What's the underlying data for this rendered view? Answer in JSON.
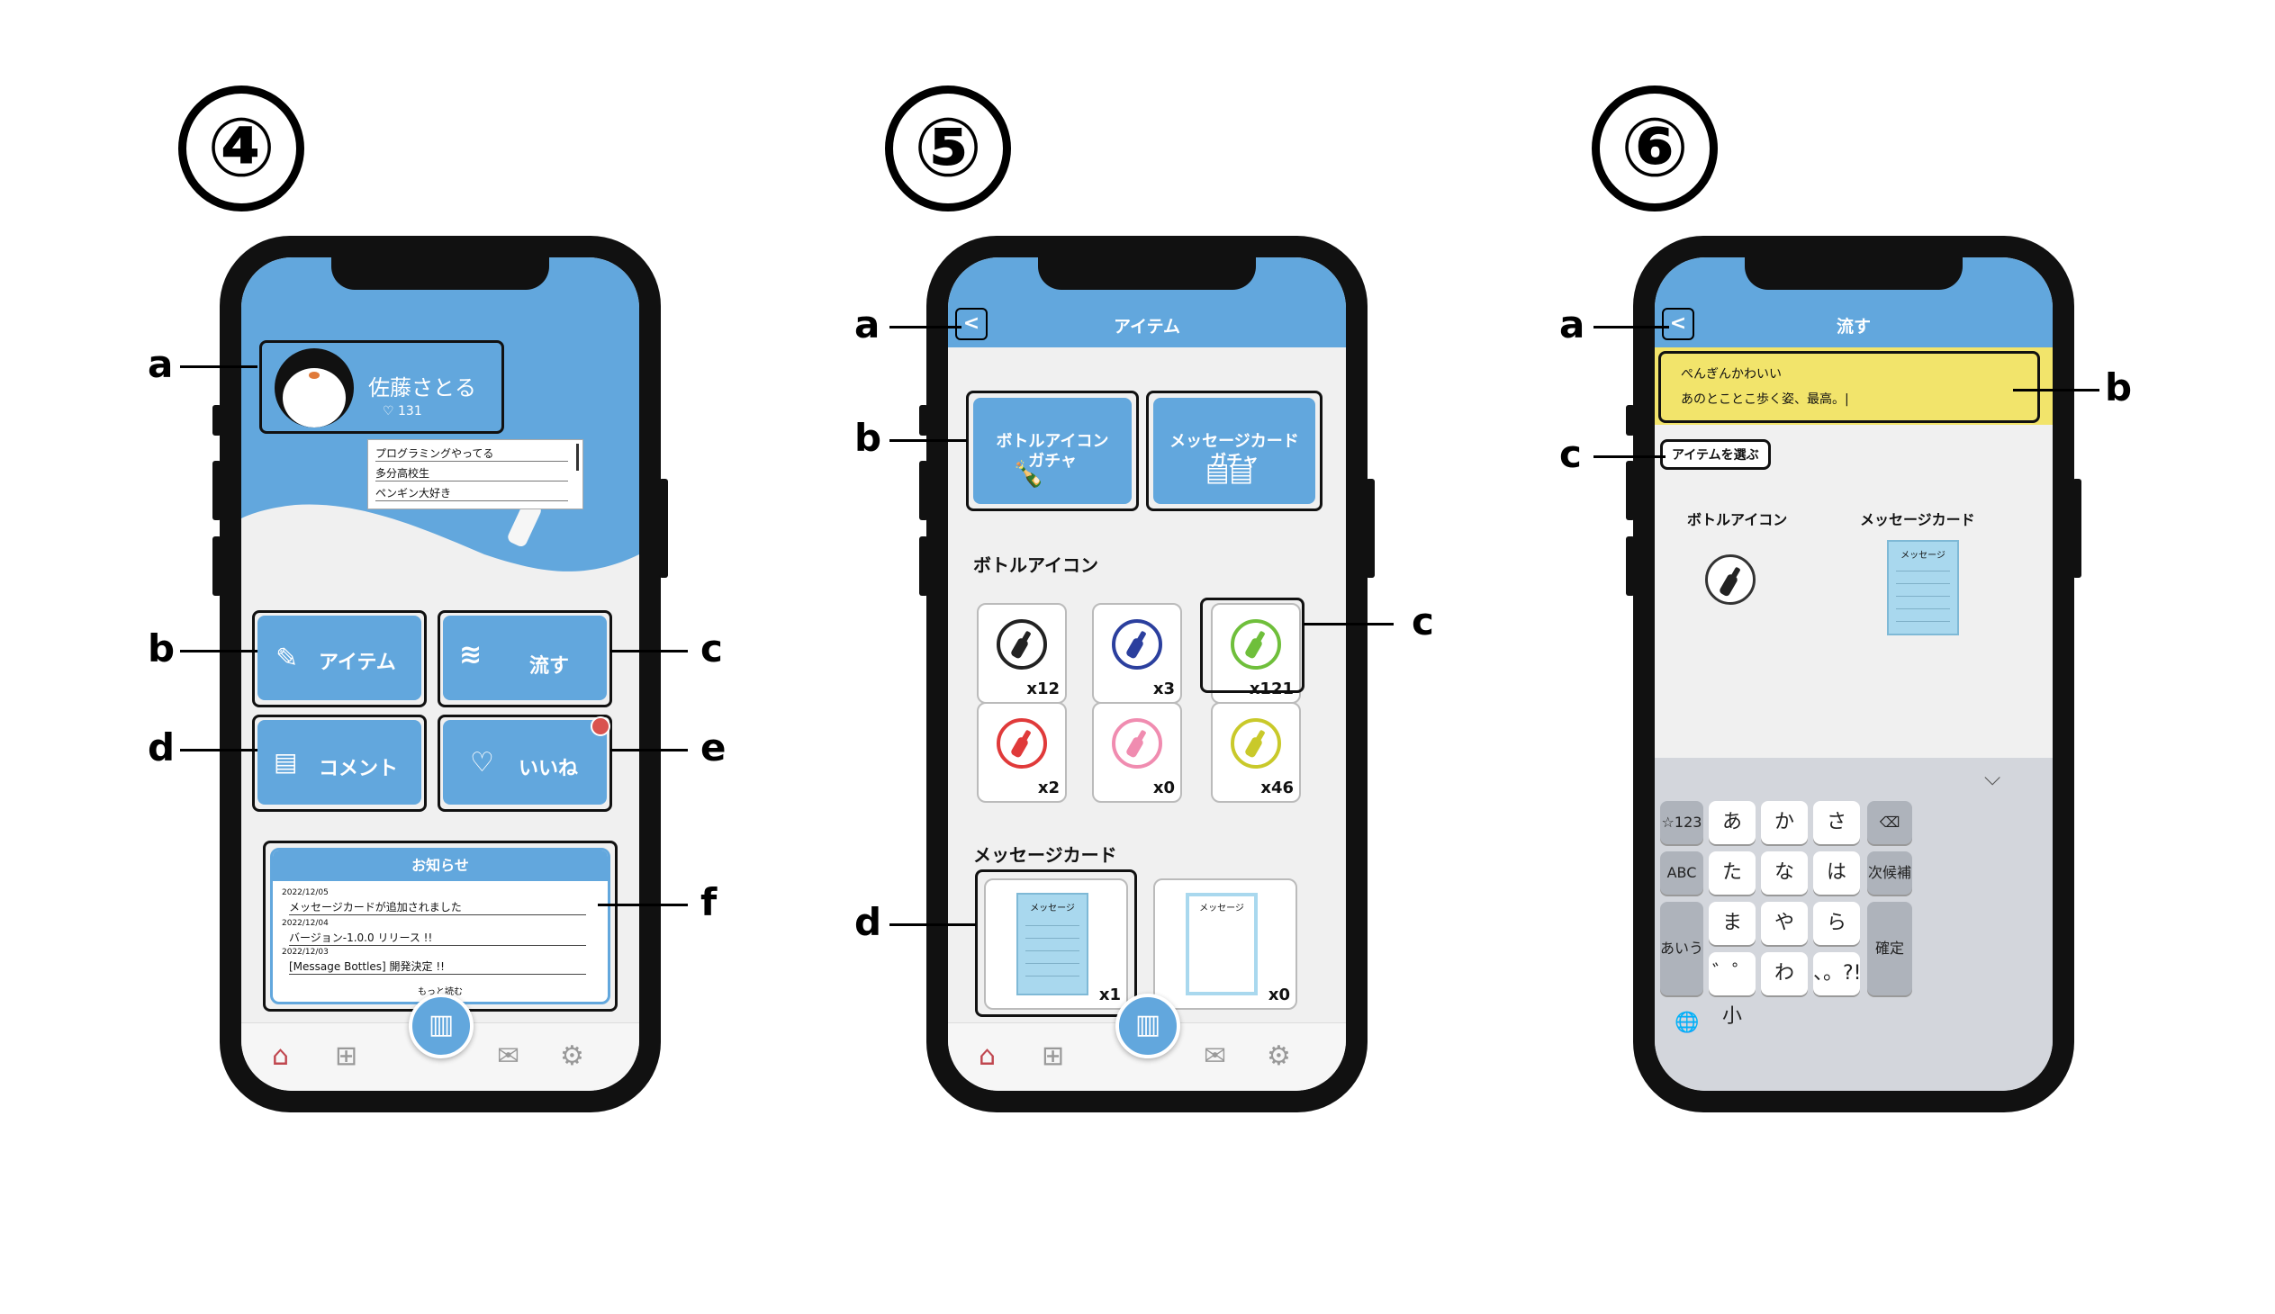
{
  "markers": {
    "s4": "④",
    "s5": "⑤",
    "s6": "⑥"
  },
  "callouts": {
    "s4": [
      "a",
      "b",
      "c",
      "d",
      "e",
      "f"
    ],
    "s5": [
      "a",
      "b",
      "c",
      "d"
    ],
    "s6": [
      "a",
      "b",
      "c"
    ]
  },
  "screen4": {
    "profile": {
      "name": "佐藤さとる",
      "likes": "131"
    },
    "bio": [
      "プログラミングやってる",
      "多分高校生",
      "ペンギン大好き"
    ],
    "buttons": {
      "item": "アイテム",
      "flow": "流す",
      "comment": "コメント",
      "like": "いいね"
    },
    "news": {
      "title": "お知らせ",
      "items": [
        {
          "date": "2022/12/05",
          "text": "メッセージカードが追加されました"
        },
        {
          "date": "2022/12/04",
          "text": "バージョン-1.0.0 リリース !!"
        },
        {
          "date": "2022/12/03",
          "text": "[Message Bottles] 開発決定 !!"
        }
      ],
      "more": "もっと読む"
    }
  },
  "screen5": {
    "title": "アイテム",
    "back": "<",
    "gacha": {
      "bottle": "ボトルアイコン\nガチャ",
      "card": "メッセージカード\nガチャ"
    },
    "bottle_section": "ボトルアイコン",
    "bottles": [
      {
        "color": "#222222",
        "count": "x12"
      },
      {
        "color": "#2b3f9e",
        "count": "x3"
      },
      {
        "color": "#6fbf3b",
        "count": "x121"
      },
      {
        "color": "#e03a3a",
        "count": "x2"
      },
      {
        "color": "#f08cb0",
        "count": "x0"
      },
      {
        "color": "#c9c92a",
        "count": "x46"
      }
    ],
    "card_section": "メッセージカード",
    "cards": [
      {
        "label": "メッセージ",
        "count": "x1"
      },
      {
        "label": "メッセージ",
        "count": "x0"
      }
    ]
  },
  "screen6": {
    "title": "流す",
    "back": "<",
    "message_lines": [
      "ぺんぎんかわいい",
      "あのとことこ歩く姿、最高。|"
    ],
    "choose": "アイテムを選ぶ",
    "bottle_label": "ボトルアイコン",
    "card_label": "メッセージカード",
    "card_text": "メッセージ",
    "keyboard": {
      "chevron": "⌵",
      "r1": [
        "☆123",
        "あ",
        "か",
        "さ",
        "⌫"
      ],
      "r2": [
        "ABC",
        "た",
        "な",
        "は",
        "次候補"
      ],
      "r3": [
        "ま",
        "や",
        "ら"
      ],
      "r4": [
        "゛゜小",
        "わ",
        "、。?!"
      ],
      "left3": "あいう",
      "confirm": "確定",
      "globe": "🌐"
    }
  },
  "tabbar_icons": [
    "home-icon",
    "add-icon",
    "map-icon",
    "mail-icon",
    "settings-icon"
  ],
  "colors": {
    "accent": "#62a7dd",
    "home_active": "#c0474f",
    "message_yellow": "#f2e46b"
  }
}
